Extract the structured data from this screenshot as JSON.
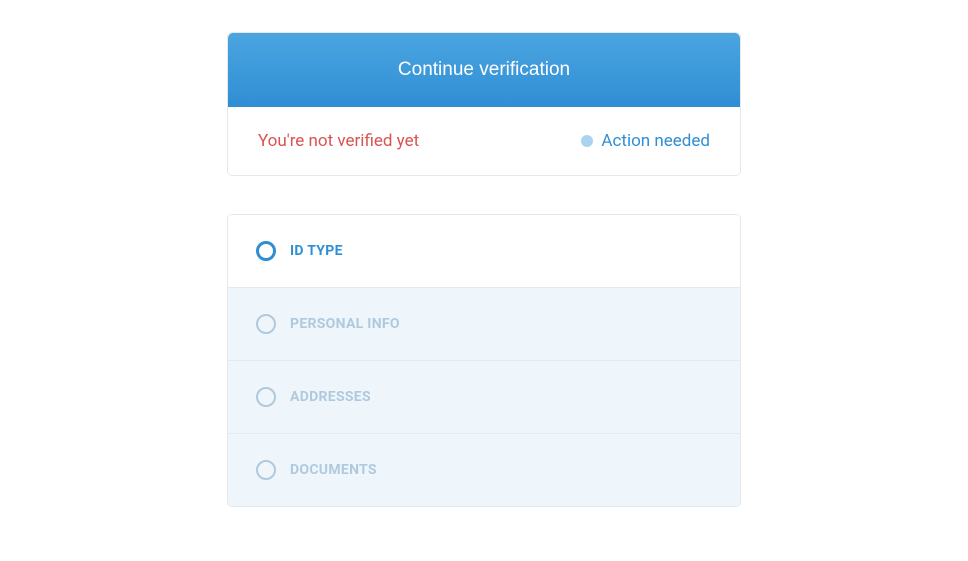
{
  "header": {
    "button_label": "Continue verification"
  },
  "status": {
    "message": "You're not verified yet",
    "action_label": "Action needed"
  },
  "steps": [
    {
      "label": "ID TYPE"
    },
    {
      "label": "PERSONAL INFO"
    },
    {
      "label": "ADDRESSES"
    },
    {
      "label": "DOCUMENTS"
    }
  ]
}
